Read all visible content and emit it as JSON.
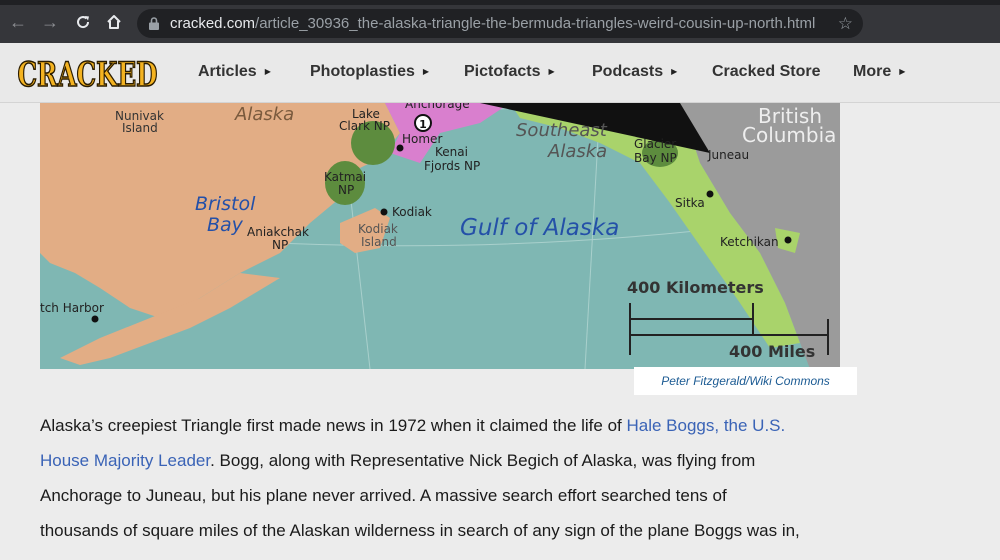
{
  "browser": {
    "url_host": "cracked.com",
    "url_path": "/article_30936_the-alaska-triangle-the-bermuda-triangles-weird-cousin-up-north.html"
  },
  "site": {
    "logo_text": "CRACKED",
    "nav": [
      {
        "label": "Articles",
        "has_menu": true
      },
      {
        "label": "Photoplasties",
        "has_menu": true
      },
      {
        "label": "Pictofacts",
        "has_menu": true
      },
      {
        "label": "Podcasts",
        "has_menu": true
      },
      {
        "label": "Cracked Store",
        "has_menu": false
      },
      {
        "label": "More",
        "has_menu": true
      }
    ]
  },
  "map": {
    "labels": {
      "alaska": "Alaska",
      "nunivak": "Nunivak",
      "nunivak2": "Island",
      "lake_clark": "Lake",
      "lake_clark2": "Clark NP",
      "anchorage": "Anchorage",
      "homer": "Homer",
      "kenai": "Kenai",
      "kenai2": "Fjords NP",
      "southeast": "Southeast",
      "southeast2": "Alaska",
      "british": "British",
      "british2": "Columbia",
      "glacier": "Glacier",
      "glacier2": "Bay NP",
      "juneau": "Juneau",
      "katmai": "Katmai",
      "katmai2": "NP",
      "bristol": "Bristol",
      "bristol2": "Bay",
      "kodiak": "Kodiak",
      "kodiak_island": "Kodiak",
      "kodiak_island2": "Island",
      "aniakchak": "Aniakchak",
      "aniakchak2": "NP",
      "gulf": "Gulf of Alaska",
      "sitka": "Sitka",
      "ketchikan": "Ketchikan",
      "dutch": "tch Harbor",
      "route_marker": "1"
    },
    "scale_km": "400 Kilometers",
    "scale_mi": "400 Miles"
  },
  "credit": "Peter Fitzgerald/Wiki Commons",
  "article": {
    "line1_a": "Alaska’s creepiest Triangle first made news in 1972 when it claimed the life of ",
    "line1_link": "Hale Boggs, the U.S.",
    "line2_link": "House Majority Leader",
    "line2_b": ". Bogg, along with Representative Nick Begich of Alaska, was flying from",
    "line3": "Anchorage to Juneau, but his plane never arrived. A massive search effort searched tens of",
    "line4": "thousands of square miles of the Alaskan wilderness in search of any sign of the plane Boggs was in,"
  },
  "colors": {
    "chrome_bg": "#35363a",
    "nav_bg": "#e9e9e9",
    "link": "#3a63b6",
    "ocean": "#7fb7b3",
    "land": "#e2ad85"
  }
}
